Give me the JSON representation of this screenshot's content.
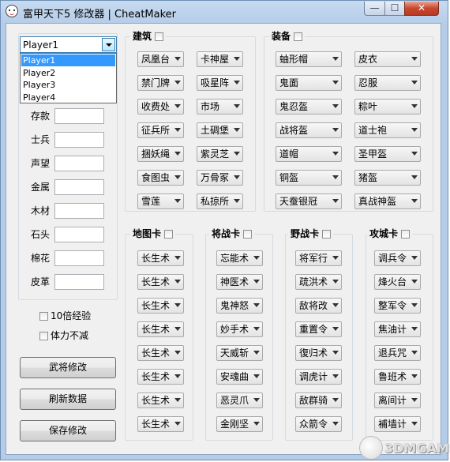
{
  "window": {
    "title": "富甲天下5 修改器 | CheatMaker",
    "controls": {
      "minimize": "—",
      "maximize": "☐",
      "close": "✕"
    }
  },
  "player": {
    "selected": "Player1",
    "options": [
      "Player1",
      "Player2",
      "Player3",
      "Player4"
    ]
  },
  "resources": [
    {
      "label": "存款",
      "value": ""
    },
    {
      "label": "士兵",
      "value": ""
    },
    {
      "label": "声望",
      "value": ""
    },
    {
      "label": "金属",
      "value": ""
    },
    {
      "label": "木材",
      "value": ""
    },
    {
      "label": "石头",
      "value": ""
    },
    {
      "label": "棉花",
      "value": ""
    },
    {
      "label": "皮革",
      "value": ""
    }
  ],
  "options": {
    "exp10": "10倍经验",
    "stamina": "体力不减"
  },
  "buttons": {
    "card_modify": "武将修改",
    "refresh": "刷新数据",
    "save": "保存修改"
  },
  "groups": {
    "building": {
      "title": "建筑",
      "items": [
        "凤凰台",
        "卡神屋",
        "禁门牌",
        "吸星阵",
        "收费处",
        "市场",
        "征兵所",
        "土碉堡",
        "捆妖绳",
        "紫灵芝",
        "食图虫",
        "万骨冢",
        "雪莲",
        "私掠所"
      ]
    },
    "equipment": {
      "title": "装备",
      "items": [
        "蚰形帽",
        "皮衣",
        "鬼面",
        "忍服",
        "鬼忍盔",
        "粽叶",
        "战将盔",
        "道士袍",
        "道帽",
        "圣甲盔",
        "铜盔",
        "猪盔",
        "天蚕银冠",
        "真战神盔"
      ]
    },
    "map_cards": {
      "title": "地图卡",
      "items": [
        "长生术",
        "长生术",
        "长生术",
        "长生术",
        "长生术",
        "长生术",
        "长生术",
        "长生术"
      ]
    },
    "general_cards": {
      "title": "将战卡",
      "items": [
        "忘能术",
        "神医术",
        "鬼神怒",
        "妙手术",
        "天威斩",
        "安魂曲",
        "恶灵爪",
        "金刚坚"
      ]
    },
    "field_cards": {
      "title": "野战卡",
      "items": [
        "将军行",
        "疏洪术",
        "敌将改",
        "重置令",
        "復归术",
        "调虎计",
        "敌群骑",
        "众箭令"
      ]
    },
    "siege_cards": {
      "title": "攻城卡",
      "items": [
        "调兵令",
        "烽火台",
        "整军令",
        "焦油计",
        "退兵咒",
        "鲁班术",
        "离间计",
        "補墙计"
      ]
    }
  },
  "watermark": {
    "text": "3DMGAME"
  }
}
